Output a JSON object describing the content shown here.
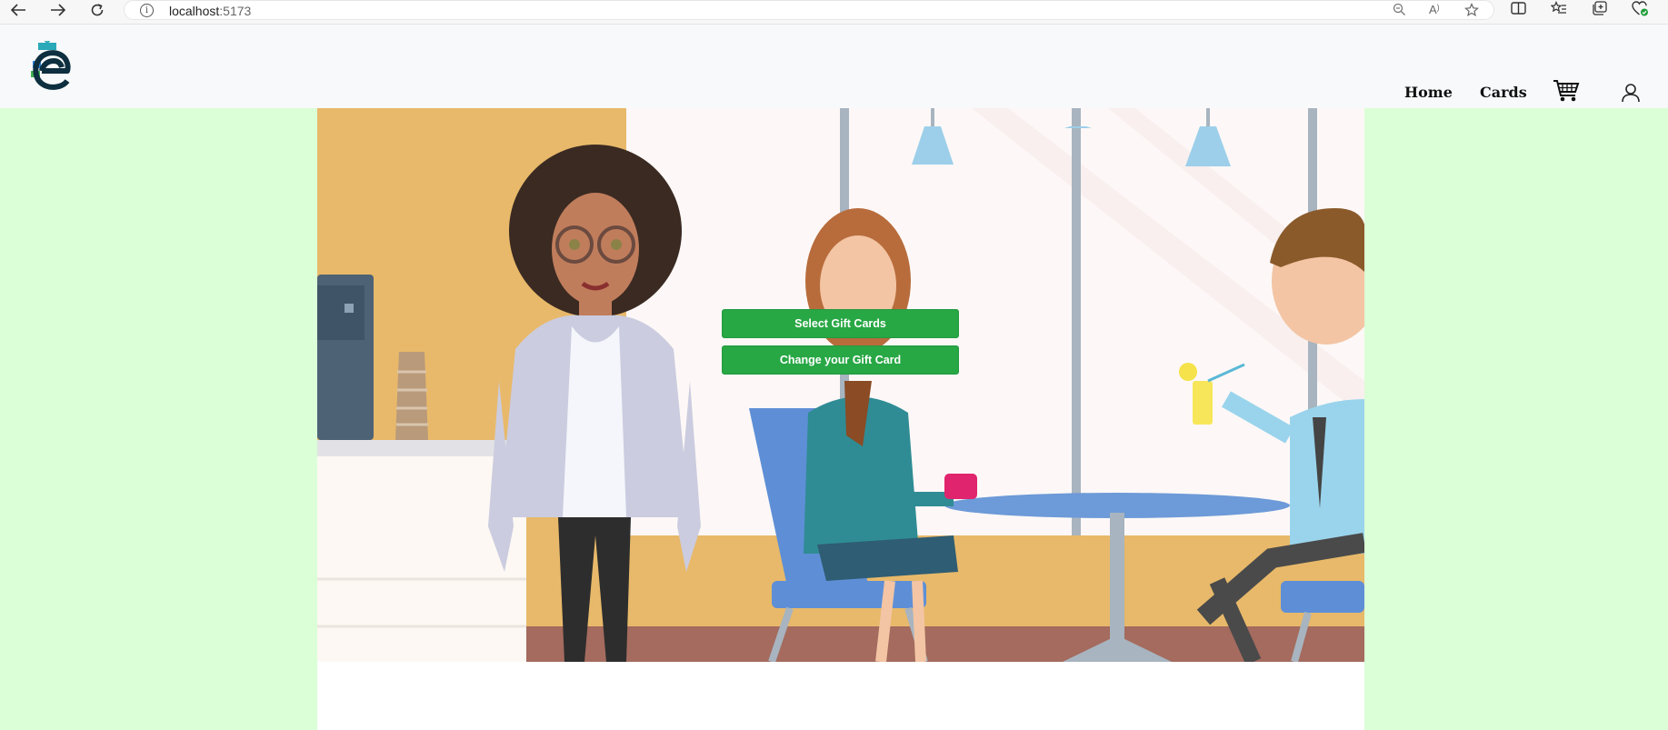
{
  "browser": {
    "url_host": "localhost",
    "url_port": ":5173"
  },
  "header": {
    "nav": {
      "home": "Home",
      "cards": "Cards"
    }
  },
  "hero": {
    "buttons": {
      "select": "Select Gift Cards",
      "change": "Change your Gift Card"
    }
  },
  "colors": {
    "page_bg": "#dbffd6",
    "header_bg": "#f8f9fa",
    "button_green": "#28a745"
  },
  "icons": [
    "back-arrow-icon",
    "forward-arrow-icon",
    "refresh-icon",
    "info-icon",
    "zoom-out-icon",
    "read-aloud-icon",
    "favorite-star-icon",
    "split-screen-icon",
    "favorites-list-icon",
    "collections-icon",
    "browser-essentials-icon",
    "cart-icon",
    "user-icon"
  ]
}
